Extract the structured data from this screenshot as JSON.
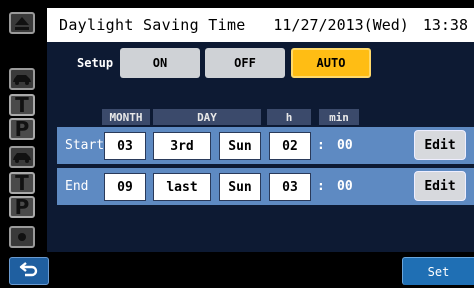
{
  "header": {
    "title": "Daylight Saving Time",
    "date": "11/27/2013(Wed)",
    "time": "13:38"
  },
  "setup": {
    "label": "Setup",
    "options": [
      "ON",
      "OFF",
      "AUTO"
    ],
    "selected": "AUTO"
  },
  "columns": {
    "month": "MONTH",
    "day": "DAY",
    "hour": "h",
    "minute": "min"
  },
  "rows": [
    {
      "label": "Start",
      "month": "03",
      "week": "3rd",
      "weekday": "Sun",
      "hour": "02",
      "colon": ":",
      "minute": "00",
      "edit_label": "Edit"
    },
    {
      "label": "End",
      "month": "09",
      "week": "last",
      "weekday": "Sun",
      "hour": "03",
      "colon": ":",
      "minute": "00",
      "edit_label": "Edit"
    }
  ],
  "sidebar": {
    "items": [
      "eject-icon",
      "car-icon",
      "T",
      "P",
      "car-icon",
      "T",
      "P",
      "dot-icon"
    ]
  },
  "footer": {
    "back_icon": "back-arrow-icon",
    "set_label": "Set"
  },
  "colors": {
    "panel": "#0d1a33",
    "row": "#5e8ac2",
    "accent": "#ffbd14",
    "button_blue": "#1f6fb4"
  }
}
